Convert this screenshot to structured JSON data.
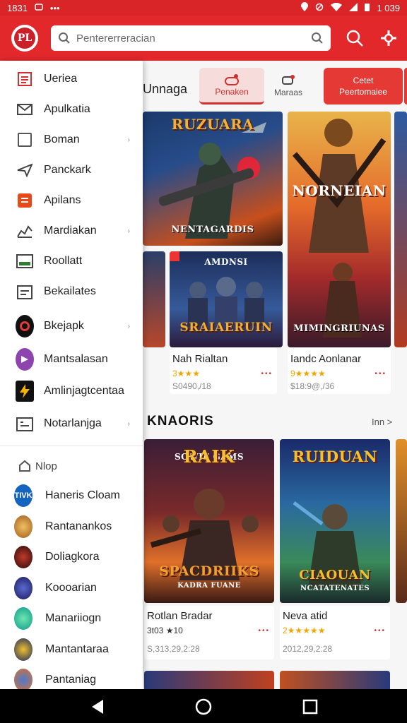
{
  "status": {
    "time": "1831",
    "right_time": "1 039"
  },
  "search": {
    "placeholder": "Pentererreracian"
  },
  "tabs": {
    "title": "Unnaga",
    "tab1": "Penaken",
    "tab2": "Maraas",
    "tab3_line1": "Cetet",
    "tab3_line2": "Peertomaiee"
  },
  "featured": [
    {
      "title": "RUZUARA",
      "subtitle": "NENTAGARDIS"
    },
    {
      "title": "NORNEIAN",
      "subtitle": "MIMINGRIUNAS"
    },
    {
      "title": "AMDNSI",
      "subtitle": "SRAIAERUIN"
    }
  ],
  "games_row1": [
    {
      "name": "Nah Rialtan",
      "rating": "3★★★",
      "price": "S0490,/18"
    },
    {
      "name": "Iandc Aonlanar",
      "rating": "9★★★★",
      "price": "$18:9@,/36"
    }
  ],
  "section": {
    "title": "KNAORIS",
    "more": "Inn >"
  },
  "games_row2": [
    {
      "name": "Rotlan Bradar",
      "rating": "3t03 ★10",
      "price": "S,313,29,2:28",
      "art_title": "RAIK",
      "art_top": "SOWIE GAMS",
      "art_bottom": "SPACDRIIKS",
      "art_sub": "KADRA FUANE"
    },
    {
      "name": "Neva atid",
      "rating": "2★★★★★",
      "price": "2012,29,2:28",
      "art_title": "RUIDUAN",
      "art_bottom": "CIAOUAN",
      "art_sub": "NCATATENATES"
    }
  ],
  "drawer": {
    "items": [
      {
        "label": "Ueriea",
        "chev": false
      },
      {
        "label": "Apulkatia",
        "chev": false
      },
      {
        "label": "Boman",
        "chev": true
      },
      {
        "label": "Panckark",
        "chev": false
      },
      {
        "label": "Apilans",
        "chev": false
      },
      {
        "label": "Mardiakan",
        "chev": true
      },
      {
        "label": "Roollatt",
        "chev": false
      },
      {
        "label": "Bekailates",
        "chev": false
      },
      {
        "label": "Bkejapk",
        "chev": true
      },
      {
        "label": "Mantsalasan",
        "chev": false
      },
      {
        "label": "Amlinjagtcentaa",
        "chev": false
      },
      {
        "label": "Notarlanjga",
        "chev": true
      }
    ],
    "section_label": "Nlop",
    "apps": [
      {
        "label": "Haneris Cloam",
        "badge": "TIVK"
      },
      {
        "label": "Rantanankos"
      },
      {
        "label": "Doliagkora"
      },
      {
        "label": "Koooarian"
      },
      {
        "label": "Manariiogn"
      },
      {
        "label": "Mantantaraa"
      },
      {
        "label": "Pantaniag"
      }
    ]
  },
  "chevron_glyph": "›",
  "colors": {
    "brand": "#e3282c",
    "accent_dark": "#c9202a"
  }
}
